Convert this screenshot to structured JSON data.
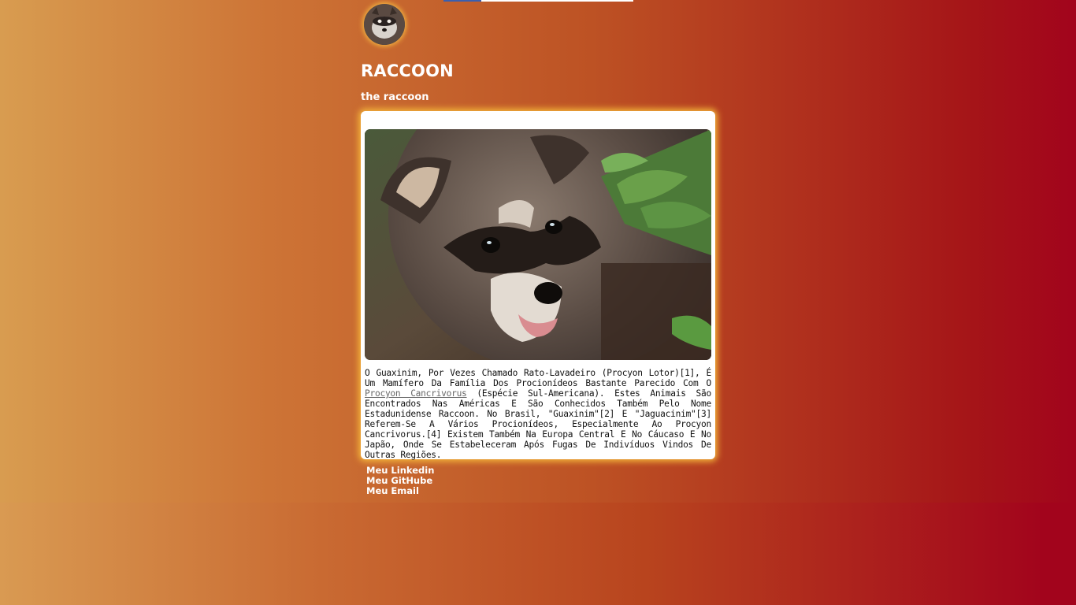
{
  "header": {
    "title": "RACCOON",
    "subtitle": "the raccoon"
  },
  "card": {
    "text_part1": "O Guaxinim, Por Vezes Chamado Rato-Lavadeiro (Procyon Lotor)[1], É Um Mamífero Da Família Dos Procionídeos Bastante Parecido Com O ",
    "link_text": "Procyon Cancrivorus",
    "text_part2": " (Espécie Sul-Americana). Estes Animais São Encontrados Nas Américas E São Conhecidos Também Pelo Nome Estadunidense Raccoon. No Brasil, \"Guaxinim\"[2] E \"Jaguacinim\"[3] Referem-Se A Vários Procionídeos, Especialmente Ao Procyon Cancrivorus.[4] Existem Também Na Europa Central E No Cáucaso E No Japão, Onde Se Estabeleceram Após Fugas De Indivíduos Vindos De Outras Regiões."
  },
  "footer": {
    "links": [
      {
        "label": "Meu Linkedin"
      },
      {
        "label": "Meu GitHube"
      },
      {
        "label": "Meu Email"
      }
    ]
  },
  "colors": {
    "card_glow": "#f3b33a",
    "link": "#666666",
    "gradient_left": "#d89c50",
    "gradient_right": "#a2041c"
  }
}
